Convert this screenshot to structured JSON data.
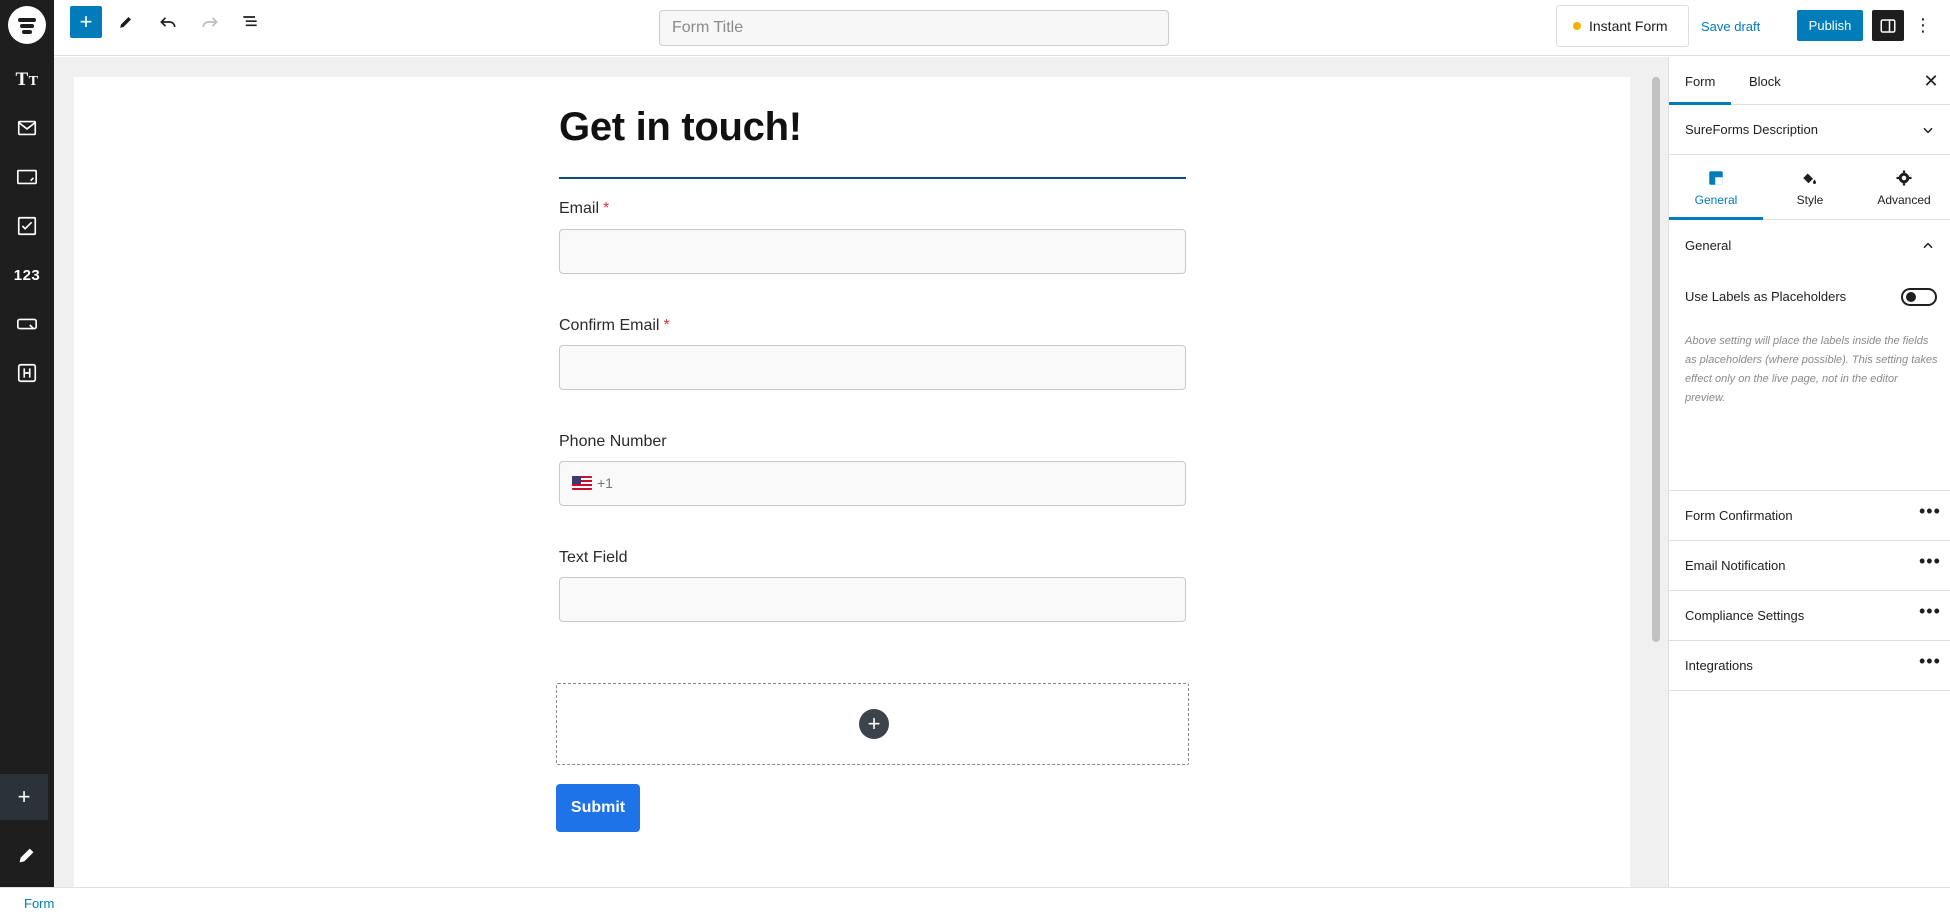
{
  "topbar": {
    "title_placeholder": "Form Title",
    "title_value": "",
    "instant_form_label": "Instant Form",
    "save_draft_label": "Save draft",
    "publish_label": "Publish"
  },
  "rail": {
    "items": [
      "typography-icon",
      "envelope-icon",
      "input-icon",
      "checkbox-icon",
      "number-icon",
      "button-icon",
      "heading-icon"
    ],
    "number_label": "123"
  },
  "form": {
    "heading": "Get in touch!",
    "fields": [
      {
        "label": "Email",
        "required": true,
        "value": ""
      },
      {
        "label": "Confirm Email",
        "required": true,
        "value": ""
      },
      {
        "label": "Phone Number",
        "required": false,
        "value": "",
        "prefix": "+1"
      },
      {
        "label": "Text Field",
        "required": false,
        "value": ""
      }
    ],
    "required_marker": "*",
    "submit_label": "Submit"
  },
  "sidebar": {
    "tabs": [
      "Form",
      "Block"
    ],
    "active_tab": "Form",
    "description_label": "SureForms Description",
    "subtabs": [
      "General",
      "Style",
      "Advanced"
    ],
    "active_subtab": "General",
    "general_section": "General",
    "toggle_label": "Use Labels as Placeholders",
    "toggle_on": false,
    "help_text": "Above setting will place the labels inside the fields as placeholders (where possible). This setting takes effect only on the live page, not in the editor preview.",
    "panels": [
      "Form Confirmation",
      "Email Notification",
      "Compliance Settings",
      "Integrations"
    ]
  },
  "statusbar": {
    "breadcrumb": "Form"
  },
  "colors": {
    "accent": "#007cba",
    "rail": "#1e1e1e",
    "submit": "#1e73e8",
    "required": "#d63638",
    "instant_dot": "#f0b400"
  }
}
